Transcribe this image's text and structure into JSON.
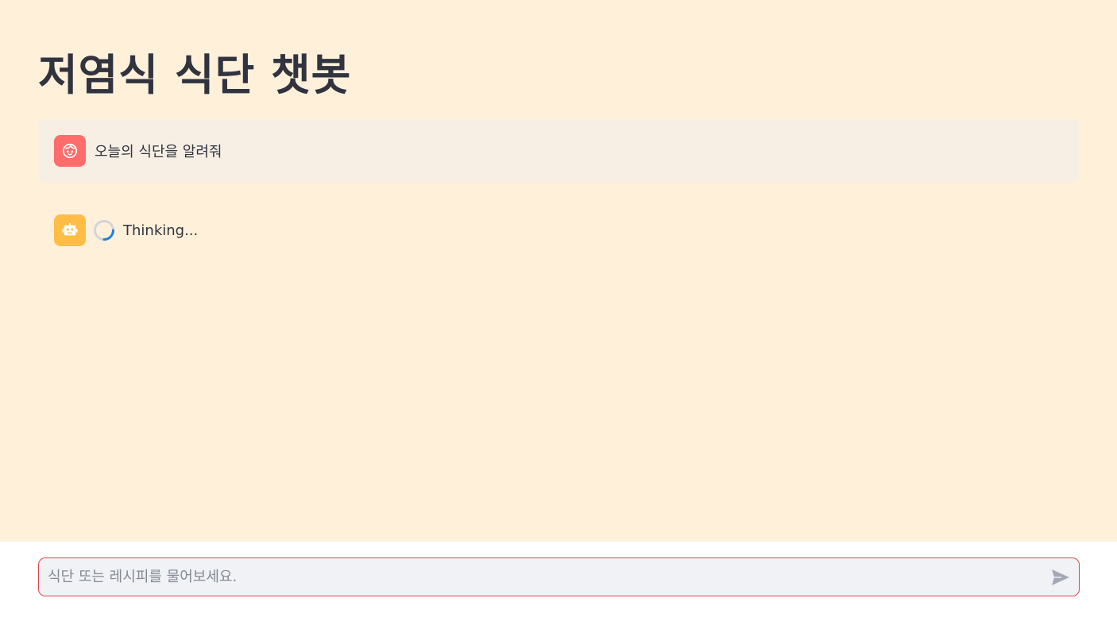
{
  "page": {
    "title": "저염식 식단 챗봇"
  },
  "messages": [
    {
      "role": "user",
      "avatar": "user-face-icon",
      "text": "오늘의 식단을 알려줘"
    },
    {
      "role": "assistant",
      "avatar": "robot-icon",
      "status": "Thinking..."
    }
  ],
  "chat_input": {
    "placeholder": "식단 또는 레시피를 물어보세요.",
    "value": "",
    "send_icon": "send-icon"
  },
  "colors": {
    "background": "#fff0da",
    "user_bubble": "#f7efe4",
    "user_avatar": "#ff6c6c",
    "bot_avatar": "#ffbd45",
    "input_border": "#e0434b",
    "spinner": "#1c83e1"
  }
}
